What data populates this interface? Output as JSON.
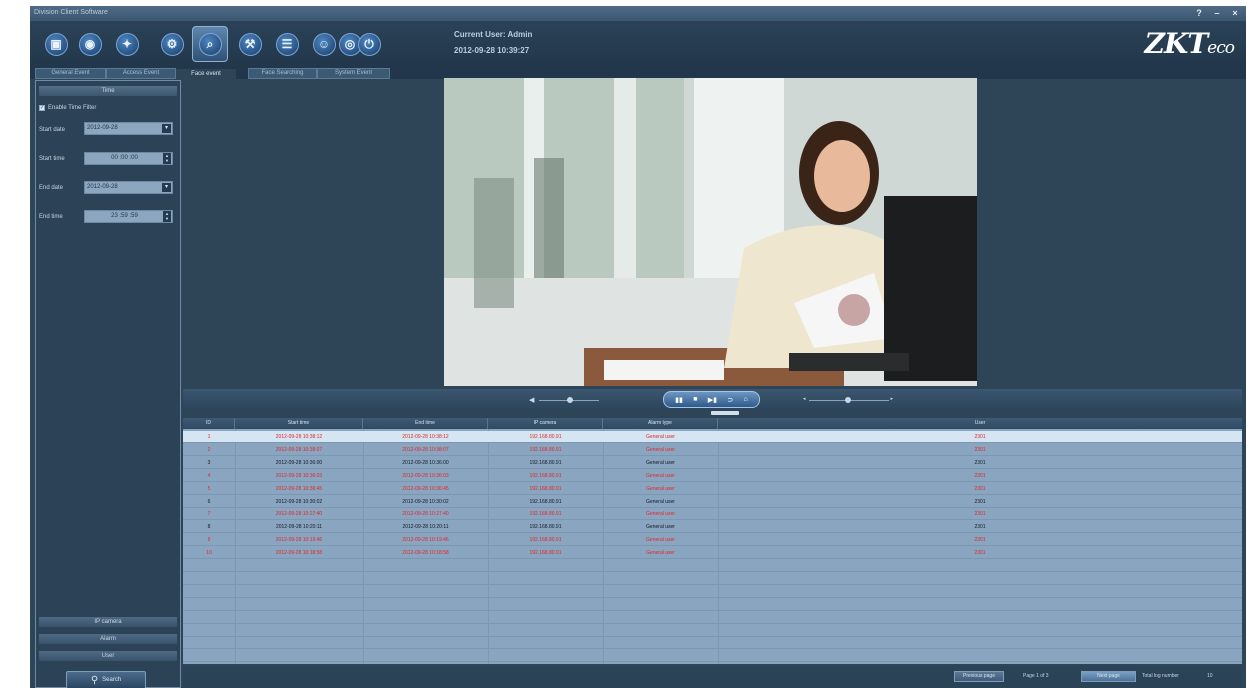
{
  "window": {
    "title": "Division Client Software"
  },
  "window_controls": [
    "?",
    "–",
    "×"
  ],
  "toolbar": {
    "buttons": [
      {
        "name": "lock",
        "glyph": "▣"
      },
      {
        "name": "location",
        "glyph": "◉"
      },
      {
        "name": "globe",
        "glyph": "✦"
      },
      {
        "name": "gear",
        "glyph": "⚙"
      },
      {
        "name": "face-search",
        "glyph": "⌕"
      },
      {
        "name": "settings",
        "glyph": "⚒"
      },
      {
        "name": "document",
        "glyph": "☰"
      },
      {
        "name": "user",
        "glyph": "☺"
      },
      {
        "name": "camera",
        "glyph": "◎"
      },
      {
        "name": "power",
        "glyph": "⏻"
      }
    ],
    "active_index": 4
  },
  "user": {
    "current_user": "Current User: Admin",
    "datetime": "2012-09-28 10:39:27"
  },
  "logo": {
    "main": "ZKT",
    "sub": "eco"
  },
  "tabs": [
    "General Event",
    "Access Event",
    "Face event",
    "Face Searching",
    "System Event"
  ],
  "active_tab": 2,
  "sidebar": {
    "time_header": "Time",
    "enable_filter": "Enable Time Filter",
    "start_date_label": "Start date",
    "start_date": "2012-09-28",
    "start_time_label": "Start time",
    "start_time": "00 :00 :00",
    "end_date_label": "End date",
    "end_date": "2012-09-28",
    "end_time_label": "End time",
    "end_time": "23 :59 :59",
    "ip_camera": "IP camera",
    "alarm": "Alarm",
    "user": "User",
    "search": "Search"
  },
  "table": {
    "headers": [
      "ID",
      "Start time",
      "End time",
      "IP camera",
      "Alarm type",
      "User"
    ],
    "rows": [
      {
        "id": "1",
        "start": "2012-09-28 10:38:12",
        "end": "2012-09-28 10:38:12",
        "ip": "192.168.80.91",
        "type": "General user",
        "user": "2301",
        "color": "red",
        "selected": true
      },
      {
        "id": "2",
        "start": "2012-09-28 10:38:07",
        "end": "2012-09-28 10:38:07",
        "ip": "192.168.80.91",
        "type": "General user",
        "user": "2301",
        "color": "red",
        "selected": false
      },
      {
        "id": "3",
        "start": "2012-09-28 10:36:00",
        "end": "2012-09-28 10:36:00",
        "ip": "192.168.80.91",
        "type": "General user",
        "user": "2301",
        "color": "black",
        "selected": false
      },
      {
        "id": "4",
        "start": "2012-09-28 10:36:03",
        "end": "2012-09-28 10:36:03",
        "ip": "192.168.80.91",
        "type": "General user",
        "user": "2301",
        "color": "red",
        "selected": false
      },
      {
        "id": "5",
        "start": "2012-09-28 10:36:45",
        "end": "2012-09-28 10:36:45",
        "ip": "192.168.80.91",
        "type": "General user",
        "user": "2301",
        "color": "red",
        "selected": false
      },
      {
        "id": "6",
        "start": "2012-09-28 10:30:02",
        "end": "2012-09-28 10:30:02",
        "ip": "192.168.80.91",
        "type": "General user",
        "user": "2301",
        "color": "black",
        "selected": false
      },
      {
        "id": "7",
        "start": "2012-09-28 10:27:40",
        "end": "2012-09-28 10:27:40",
        "ip": "192.168.80.91",
        "type": "General user",
        "user": "2301",
        "color": "red",
        "selected": false
      },
      {
        "id": "8",
        "start": "2012-09-28 10:20:11",
        "end": "2012-09-28 10:20:11",
        "ip": "192.168.80.91",
        "type": "General user",
        "user": "2301",
        "color": "black",
        "selected": false
      },
      {
        "id": "9",
        "start": "2012-09-28 10:19:46",
        "end": "2012-09-28 10:19:46",
        "ip": "192.168.80.91",
        "type": "General user",
        "user": "2301",
        "color": "red",
        "selected": false
      },
      {
        "id": "10",
        "start": "2012-09-28 10:18:58",
        "end": "2012-09-28 10:18:58",
        "ip": "192.168.80.91",
        "type": "General user",
        "user": "2301",
        "color": "red",
        "selected": false
      }
    ]
  },
  "status": {
    "prev": "Previous page",
    "page_info": "Page 1 of 3",
    "next": "Next page",
    "total_label": "Total log number",
    "total": "10"
  },
  "playback": {
    "buttons": [
      "▮▮",
      "■",
      "▶▮",
      "⊃",
      "⌂"
    ]
  }
}
